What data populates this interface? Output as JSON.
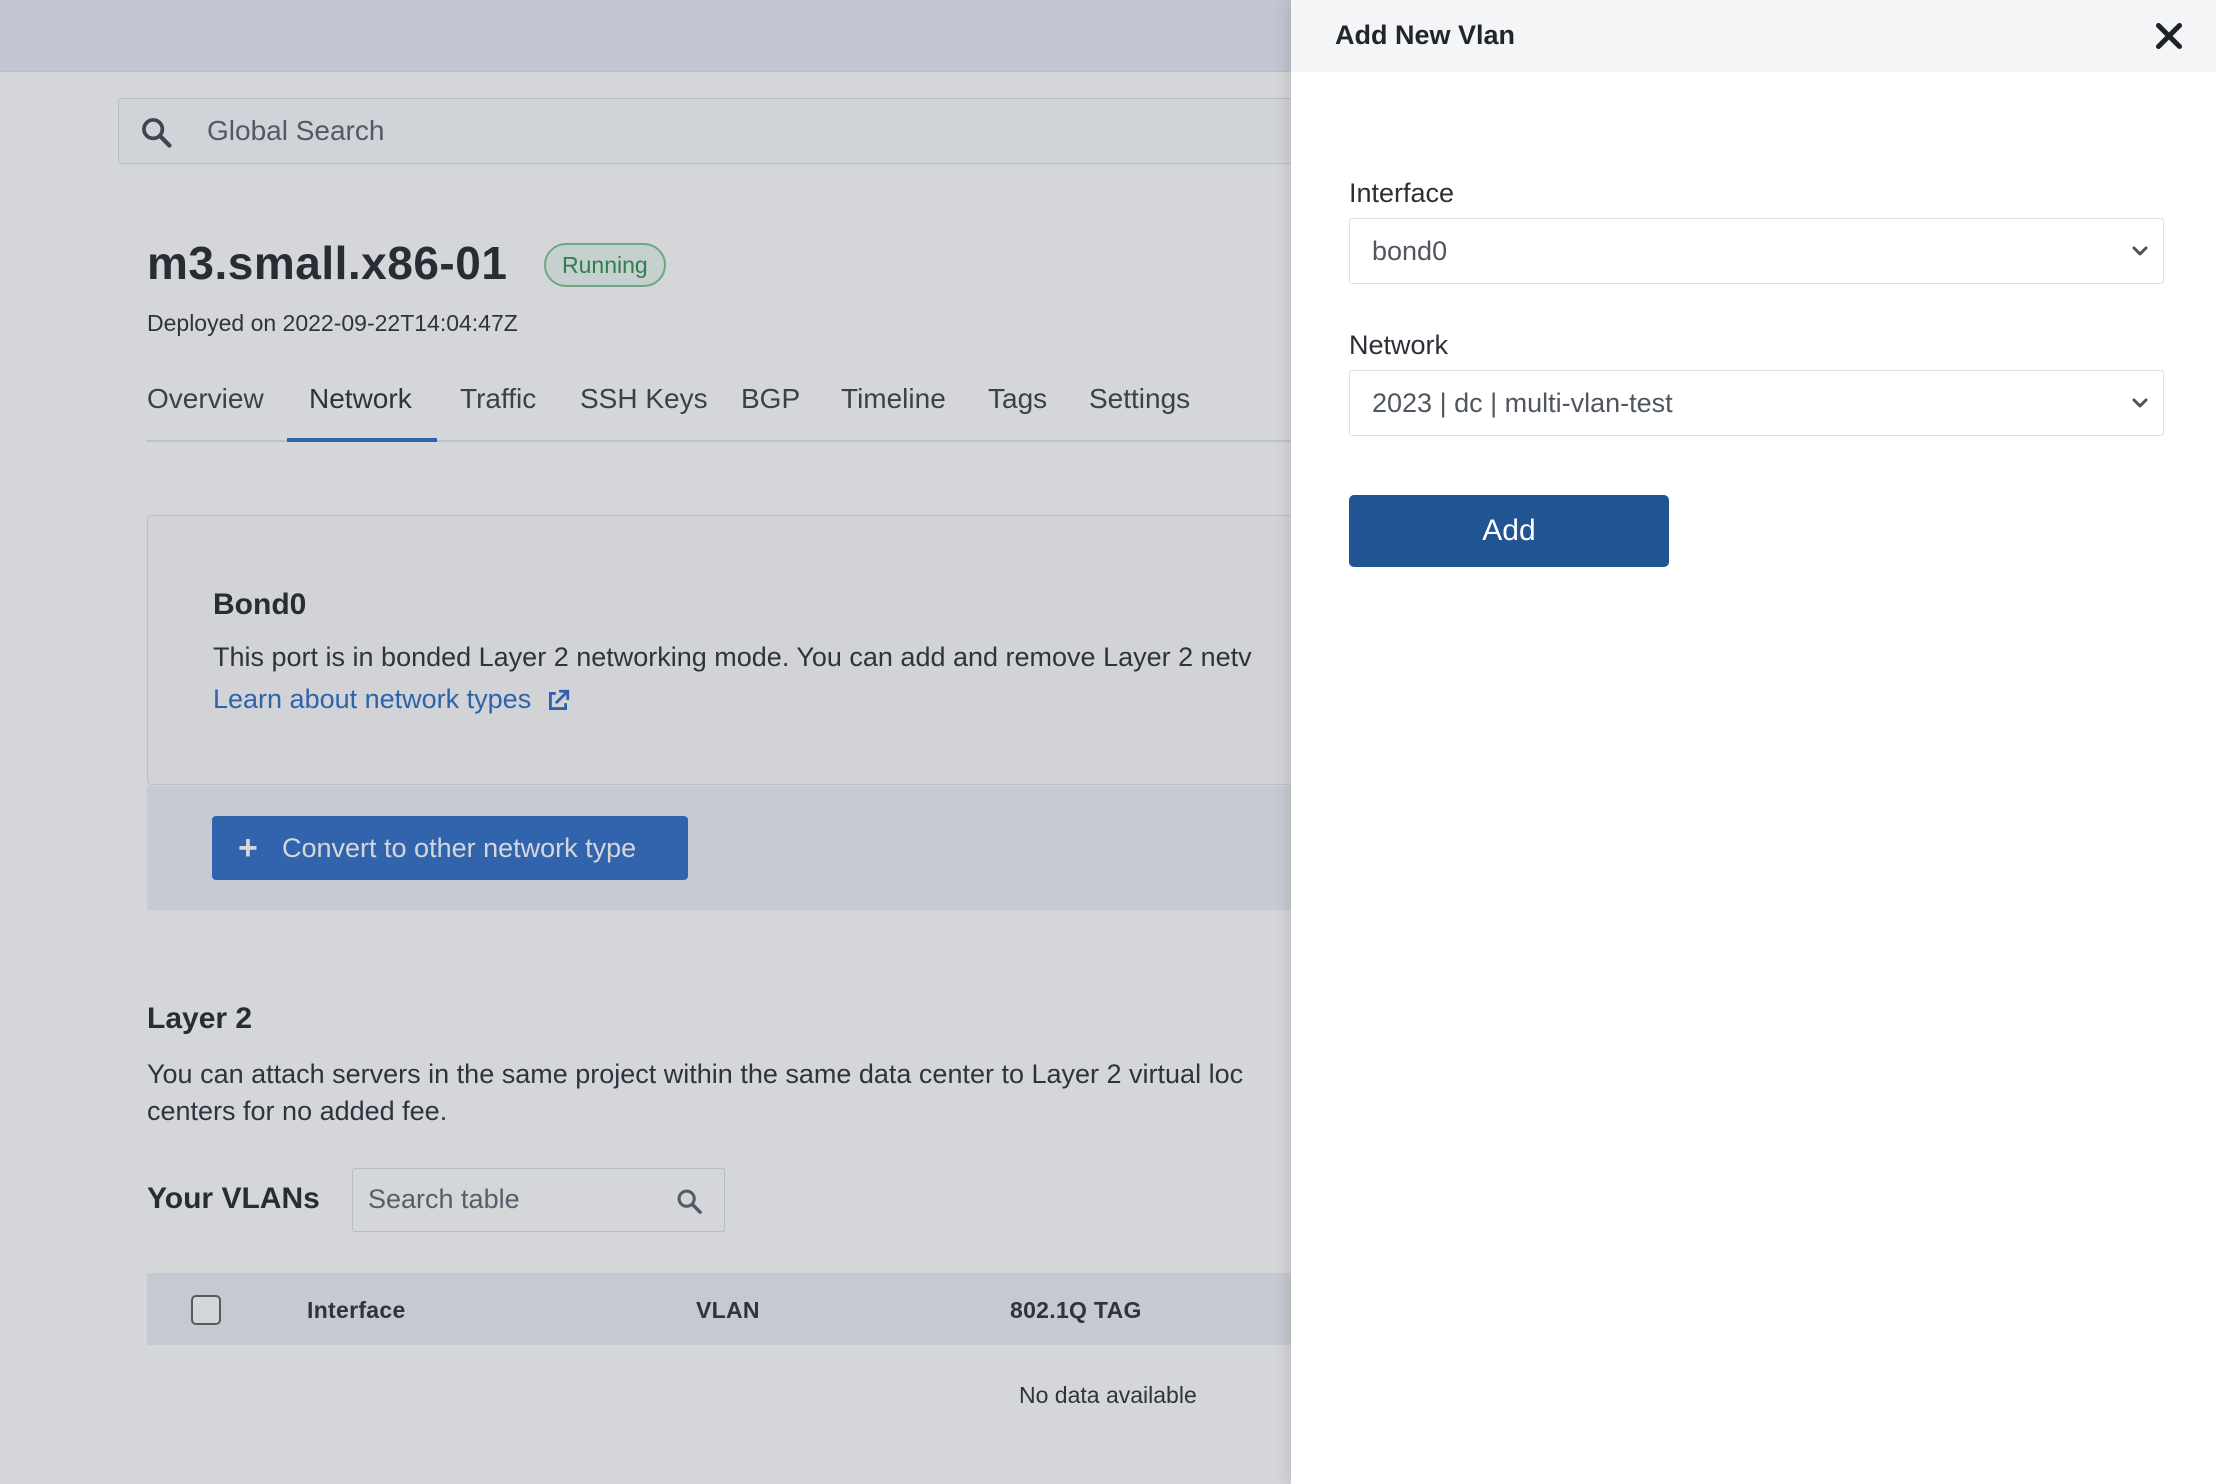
{
  "header": {
    "search_placeholder": "Global Search"
  },
  "server": {
    "name": "m3.small.x86-01",
    "status": "Running",
    "deployed": "Deployed on 2022-09-22T14:04:47Z"
  },
  "tabs": [
    {
      "label": "Overview"
    },
    {
      "label": "Network",
      "active": true
    },
    {
      "label": "Traffic"
    },
    {
      "label": "SSH Keys"
    },
    {
      "label": "BGP"
    },
    {
      "label": "Timeline"
    },
    {
      "label": "Tags"
    },
    {
      "label": "Settings"
    }
  ],
  "bond": {
    "title": "Bond0",
    "description": "This port is in bonded Layer 2 networking mode. You can add and remove Layer 2 netv",
    "learn_link": "Learn about network types",
    "convert_button": "Convert to other network type"
  },
  "layer2": {
    "title": "Layer 2",
    "desc_line1": "You can attach servers in the same project within the same data center to Layer 2 virtual loc",
    "desc_line2": "centers for no added fee."
  },
  "vlans": {
    "title": "Your VLANs",
    "search_placeholder": "Search table",
    "columns": [
      "Interface",
      "VLAN",
      "802.1Q TAG"
    ],
    "empty_text": "No data available"
  },
  "drawer": {
    "title": "Add New Vlan",
    "interface_label": "Interface",
    "interface_value": "bond0",
    "network_label": "Network",
    "network_value": "2023 | dc | multi-vlan-test",
    "add_button": "Add"
  },
  "colors": {
    "accent": "#2f6ec5",
    "add_button": "#215493",
    "status_green": "#2f8e4c",
    "overlay": "rgba(60,70,85,0.22)"
  }
}
